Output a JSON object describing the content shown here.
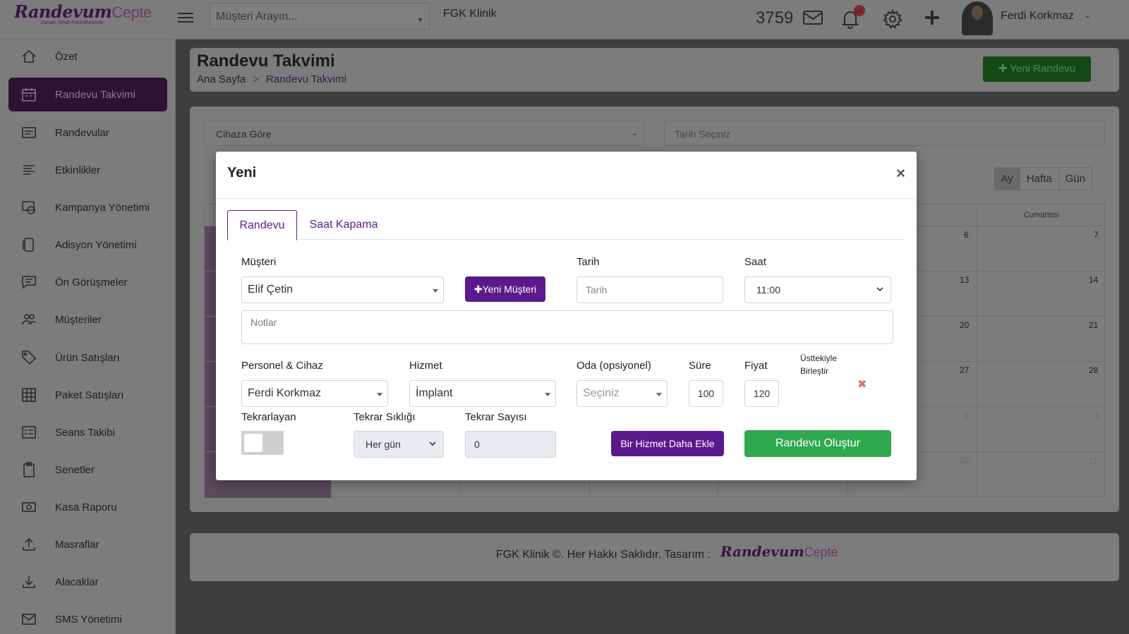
{
  "brand": {
    "logo_main": "Randevum",
    "logo_suffix": "Cepte",
    "logo_tagline": "Zaman Şimdi Kontrolünüzde"
  },
  "topbar": {
    "search_placeholder": "Müşteri Arayın...",
    "clinic_name": "FGK Klinik",
    "sms_count": "3759",
    "notification_count": "23",
    "user_name": "Ferdi Korkmaz"
  },
  "sidebar": {
    "items": [
      {
        "label": "Özet",
        "icon": "home-icon"
      },
      {
        "label": "Randevu Takvimi",
        "icon": "calendar-icon",
        "active": true
      },
      {
        "label": "Randevular",
        "icon": "list-icon"
      },
      {
        "label": "Etkinlikler",
        "icon": "lines-icon"
      },
      {
        "label": "Kampanya Yönetimi",
        "icon": "campaign-icon"
      },
      {
        "label": "Adisyon Yönetimi",
        "icon": "receipt-icon"
      },
      {
        "label": "Ön Görüşmeler",
        "icon": "chat-icon"
      },
      {
        "label": "Müşteriler",
        "icon": "users-icon"
      },
      {
        "label": "Ürün Satışları",
        "icon": "tag-icon"
      },
      {
        "label": "Paket Satışları",
        "icon": "grid-icon"
      },
      {
        "label": "Seans Takibi",
        "icon": "checklist-icon"
      },
      {
        "label": "Senetler",
        "icon": "clipboard-icon"
      },
      {
        "label": "Kasa Raporu",
        "icon": "cash-icon"
      },
      {
        "label": "Masraflar",
        "icon": "upload-icon"
      },
      {
        "label": "Alacaklar",
        "icon": "download-icon"
      },
      {
        "label": "SMS Yönetimi",
        "icon": "mail-icon"
      }
    ]
  },
  "page": {
    "title": "Randevu Takvimi",
    "breadcrumb_home": "Ana Sayfa",
    "breadcrumb_sep": ">",
    "breadcrumb_current": "Randevu Takvimi",
    "new_button": "✚ Yeni Randevu"
  },
  "calendar": {
    "filter_label": "Cihaza Göre",
    "date_placeholder": "Tarih Seçiniz",
    "views": [
      "Ay",
      "Hafta",
      "Gün"
    ],
    "visible_headers": [
      "a",
      "Cumartesi"
    ],
    "col_a_numbers": [
      "6",
      "13",
      "20",
      "27",
      "3",
      "10"
    ],
    "col_b_numbers": [
      "7",
      "14",
      "21",
      "28",
      "4",
      "11"
    ]
  },
  "footer": {
    "text": "FGK Klinik ©. Her Hakkı Saklıdır. Tasarım :",
    "logo_main": "Randevum",
    "logo_suffix": "Cepte"
  },
  "modal": {
    "title": "Yeni",
    "close": "×",
    "tabs": [
      "Randevu",
      "Saat Kapama"
    ],
    "customer_label": "Müşteri",
    "customer_value": "Elif Çetin",
    "new_customer_button": "✚Yeni Müşteri",
    "date_label": "Tarih",
    "date_placeholder": "Tarih",
    "time_label": "Saat",
    "time_value": "11:00",
    "notes_placeholder": "Notlar",
    "staff_label": "Personel & Cihaz",
    "staff_value": "Ferdi Korkmaz",
    "service_label": "Hizmet",
    "service_value": "İmplant",
    "room_label": "Oda (opsiyonel)",
    "room_placeholder": "Seçiniz",
    "duration_label": "Süre",
    "duration_value": "100",
    "price_label": "Fiyat",
    "price_value": "120",
    "merge_label_1": "Üsttekiyle",
    "merge_label_2": "Birleştir",
    "remove_icon": "✖",
    "repeat_label": "Tekrarlayan",
    "frequency_label": "Tekrar Sıklığı",
    "frequency_value": "Her gün",
    "repeat_count_label": "Tekrar Sayısı",
    "repeat_count_value": "0",
    "add_service_button": "Bir Hizmet Daha Ekle",
    "create_button": "Randevu Oluştur"
  },
  "colors": {
    "brand_purple": "#5b1a8c",
    "success_green": "#2fa94e",
    "remove_red": "#e06a6a"
  }
}
